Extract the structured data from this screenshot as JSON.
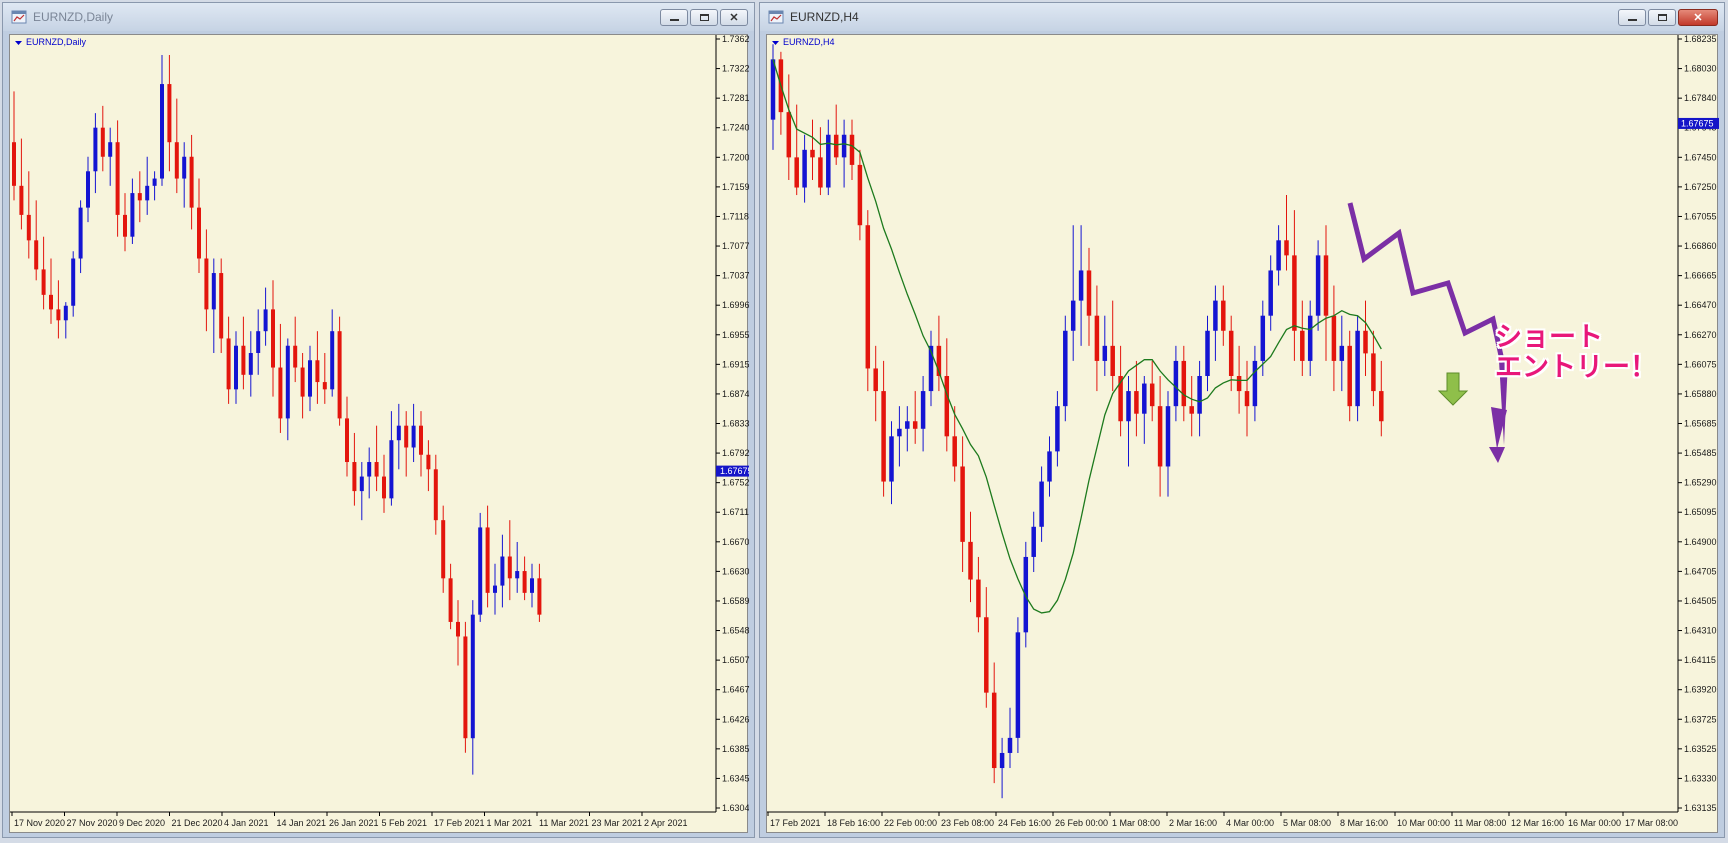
{
  "colors": {
    "chart_bg": "#f7f4dc",
    "bull": "#1414d2",
    "bear": "#e3150d",
    "ma": "#1d7a1d",
    "price_tag_bg": "#1515c8",
    "annotation": "#e8177a",
    "arrow_path": "#7b2fa5",
    "arrow_green": "#8fbf4a"
  },
  "icons": {
    "window_icon": "chart-window-icon",
    "dropdown": "triangle-down-icon"
  },
  "left": {
    "window_title": "EURNZD,Daily",
    "symbol_label": "EURNZD,Daily",
    "price_tag": "1.67675",
    "price_levels": [
      "1.73620",
      "1.73220",
      "1.72810",
      "1.72400",
      "1.72000",
      "1.71590",
      "1.71180",
      "1.70770",
      "1.70370",
      "1.69960",
      "1.69550",
      "1.69150",
      "1.68740",
      "1.68330",
      "1.67920",
      "1.67520",
      "1.67110",
      "1.66700",
      "1.66300",
      "1.65890",
      "1.65480",
      "1.65070",
      "1.64670",
      "1.64260",
      "1.63850",
      "1.63450",
      "1.63040"
    ],
    "time_labels": [
      "17 Nov 2020",
      "27 Nov 2020",
      "9 Dec 2020",
      "21 Dec 2020",
      "4 Jan 2021",
      "14 Jan 2021",
      "26 Jan 2021",
      "5 Feb 2021",
      "17 Feb 2021",
      "1 Mar 2021",
      "11 Mar 2021",
      "23 Mar 2021",
      "2 Apr 2021"
    ]
  },
  "right": {
    "window_title": "EURNZD,H4",
    "symbol_label": "EURNZD,H4",
    "price_tag": "1.67675",
    "price_levels": [
      "1.68235",
      "1.68030",
      "1.67840",
      "1.67645",
      "1.67450",
      "1.67250",
      "1.67055",
      "1.66860",
      "1.66665",
      "1.66470",
      "1.66270",
      "1.66075",
      "1.65880",
      "1.65685",
      "1.65485",
      "1.65290",
      "1.65095",
      "1.64900",
      "1.64705",
      "1.64505",
      "1.64310",
      "1.64115",
      "1.63920",
      "1.63725",
      "1.63525",
      "1.63330",
      "1.63135"
    ],
    "time_labels": [
      "17 Feb 2021",
      "18 Feb 16:00",
      "22 Feb 00:00",
      "23 Feb 08:00",
      "24 Feb 16:00",
      "26 Feb 00:00",
      "1 Mar 08:00",
      "2 Mar 16:00",
      "4 Mar 00:00",
      "5 Mar 08:00",
      "8 Mar 16:00",
      "10 Mar 00:00",
      "11 Mar 08:00",
      "12 Mar 16:00",
      "16 Mar 00:00",
      "17 Mar 08:00"
    ],
    "annotation_line1": "ショート",
    "annotation_line2": "エントリー！"
  },
  "chart_data": [
    {
      "type": "candlestick",
      "title": "EURNZD,Daily",
      "ylim": [
        1.6304,
        1.7362
      ],
      "current_price": 1.67675,
      "candles": [
        [
          1.722,
          1.729,
          1.714,
          1.716
        ],
        [
          1.716,
          1.7225,
          1.71,
          1.712
        ],
        [
          1.712,
          1.718,
          1.706,
          1.7085
        ],
        [
          1.7085,
          1.714,
          1.703,
          1.7045
        ],
        [
          1.7045,
          1.709,
          1.699,
          1.701
        ],
        [
          1.701,
          1.706,
          1.697,
          1.699
        ],
        [
          1.699,
          1.703,
          1.695,
          1.6975
        ],
        [
          1.6975,
          1.7,
          1.695,
          1.6995
        ],
        [
          1.6995,
          1.707,
          1.698,
          1.706
        ],
        [
          1.706,
          1.714,
          1.704,
          1.713
        ],
        [
          1.713,
          1.72,
          1.711,
          1.718
        ],
        [
          1.718,
          1.726,
          1.715,
          1.724
        ],
        [
          1.724,
          1.727,
          1.718,
          1.72
        ],
        [
          1.72,
          1.724,
          1.716,
          1.722
        ],
        [
          1.722,
          1.725,
          1.709,
          1.712
        ],
        [
          1.712,
          1.715,
          1.707,
          1.709
        ],
        [
          1.709,
          1.717,
          1.708,
          1.715
        ],
        [
          1.715,
          1.718,
          1.711,
          1.714
        ],
        [
          1.714,
          1.72,
          1.712,
          1.716
        ],
        [
          1.716,
          1.718,
          1.714,
          1.717
        ],
        [
          1.717,
          1.734,
          1.716,
          1.73
        ],
        [
          1.73,
          1.734,
          1.718,
          1.722
        ],
        [
          1.722,
          1.728,
          1.715,
          1.717
        ],
        [
          1.717,
          1.722,
          1.713,
          1.72
        ],
        [
          1.72,
          1.723,
          1.71,
          1.713
        ],
        [
          1.713,
          1.717,
          1.704,
          1.706
        ],
        [
          1.706,
          1.71,
          1.696,
          1.699
        ],
        [
          1.699,
          1.706,
          1.693,
          1.704
        ],
        [
          1.704,
          1.706,
          1.693,
          1.695
        ],
        [
          1.695,
          1.698,
          1.686,
          1.688
        ],
        [
          1.688,
          1.696,
          1.686,
          1.694
        ],
        [
          1.694,
          1.698,
          1.688,
          1.69
        ],
        [
          1.69,
          1.696,
          1.687,
          1.693
        ],
        [
          1.693,
          1.699,
          1.69,
          1.696
        ],
        [
          1.696,
          1.702,
          1.694,
          1.699
        ],
        [
          1.699,
          1.703,
          1.687,
          1.691
        ],
        [
          1.691,
          1.697,
          1.682,
          1.684
        ],
        [
          1.684,
          1.695,
          1.681,
          1.694
        ],
        [
          1.694,
          1.698,
          1.689,
          1.691
        ],
        [
          1.691,
          1.693,
          1.684,
          1.687
        ],
        [
          1.687,
          1.694,
          1.685,
          1.692
        ],
        [
          1.692,
          1.696,
          1.686,
          1.689
        ],
        [
          1.689,
          1.693,
          1.686,
          1.688
        ],
        [
          1.688,
          1.699,
          1.687,
          1.696
        ],
        [
          1.696,
          1.698,
          1.683,
          1.684
        ],
        [
          1.684,
          1.687,
          1.676,
          1.678
        ],
        [
          1.678,
          1.682,
          1.672,
          1.674
        ],
        [
          1.674,
          1.678,
          1.67,
          1.676
        ],
        [
          1.676,
          1.68,
          1.673,
          1.678
        ],
        [
          1.678,
          1.683,
          1.674,
          1.676
        ],
        [
          1.676,
          1.679,
          1.671,
          1.673
        ],
        [
          1.673,
          1.685,
          1.672,
          1.681
        ],
        [
          1.681,
          1.686,
          1.677,
          1.683
        ],
        [
          1.683,
          1.685,
          1.676,
          1.68
        ],
        [
          1.68,
          1.686,
          1.678,
          1.683
        ],
        [
          1.683,
          1.685,
          1.676,
          1.679
        ],
        [
          1.679,
          1.681,
          1.674,
          1.677
        ],
        [
          1.677,
          1.679,
          1.668,
          1.67
        ],
        [
          1.67,
          1.672,
          1.66,
          1.662
        ],
        [
          1.662,
          1.664,
          1.655,
          1.656
        ],
        [
          1.656,
          1.659,
          1.65,
          1.654
        ],
        [
          1.654,
          1.656,
          1.638,
          1.64
        ],
        [
          1.64,
          1.659,
          1.635,
          1.657
        ],
        [
          1.657,
          1.671,
          1.656,
          1.669
        ],
        [
          1.669,
          1.672,
          1.658,
          1.66
        ],
        [
          1.66,
          1.664,
          1.657,
          1.661
        ],
        [
          1.661,
          1.668,
          1.658,
          1.665
        ],
        [
          1.665,
          1.67,
          1.659,
          1.662
        ],
        [
          1.662,
          1.667,
          1.66,
          1.663
        ],
        [
          1.663,
          1.665,
          1.659,
          1.66
        ],
        [
          1.66,
          1.664,
          1.658,
          1.662
        ],
        [
          1.662,
          1.664,
          1.656,
          1.657
        ]
      ]
    },
    {
      "type": "candlestick",
      "title": "EURNZD,H4",
      "ylim": [
        1.63135,
        1.68235
      ],
      "current_price": 1.67675,
      "moving_average": true,
      "candles": [
        [
          1.677,
          1.682,
          1.675,
          1.681
        ],
        [
          1.681,
          1.6815,
          1.676,
          1.6775
        ],
        [
          1.6775,
          1.68,
          1.673,
          1.6745
        ],
        [
          1.6745,
          1.678,
          1.672,
          1.6725
        ],
        [
          1.6725,
          1.676,
          1.6715,
          1.675
        ],
        [
          1.675,
          1.677,
          1.673,
          1.6745
        ],
        [
          1.6745,
          1.6765,
          1.672,
          1.6725
        ],
        [
          1.6725,
          1.677,
          1.672,
          1.676
        ],
        [
          1.676,
          1.678,
          1.674,
          1.6745
        ],
        [
          1.6745,
          1.677,
          1.6725,
          1.676
        ],
        [
          1.676,
          1.677,
          1.673,
          1.674
        ],
        [
          1.674,
          1.675,
          1.669,
          1.67
        ],
        [
          1.67,
          1.671,
          1.659,
          1.6605
        ],
        [
          1.6605,
          1.662,
          1.657,
          1.659
        ],
        [
          1.659,
          1.661,
          1.652,
          1.653
        ],
        [
          1.653,
          1.657,
          1.6515,
          1.656
        ],
        [
          1.656,
          1.658,
          1.654,
          1.6565
        ],
        [
          1.6565,
          1.658,
          1.655,
          1.657
        ],
        [
          1.657,
          1.659,
          1.6555,
          1.6565
        ],
        [
          1.6565,
          1.66,
          1.655,
          1.659
        ],
        [
          1.659,
          1.663,
          1.658,
          1.662
        ],
        [
          1.662,
          1.664,
          1.659,
          1.66
        ],
        [
          1.66,
          1.6625,
          1.655,
          1.656
        ],
        [
          1.656,
          1.658,
          1.653,
          1.654
        ],
        [
          1.654,
          1.656,
          1.647,
          1.649
        ],
        [
          1.649,
          1.651,
          1.645,
          1.6465
        ],
        [
          1.6465,
          1.648,
          1.643,
          1.644
        ],
        [
          1.644,
          1.646,
          1.638,
          1.639
        ],
        [
          1.639,
          1.641,
          1.633,
          1.634
        ],
        [
          1.634,
          1.636,
          1.632,
          1.635
        ],
        [
          1.635,
          1.638,
          1.634,
          1.636
        ],
        [
          1.636,
          1.644,
          1.635,
          1.643
        ],
        [
          1.643,
          1.649,
          1.642,
          1.648
        ],
        [
          1.648,
          1.651,
          1.647,
          1.65
        ],
        [
          1.65,
          1.654,
          1.649,
          1.653
        ],
        [
          1.653,
          1.656,
          1.652,
          1.655
        ],
        [
          1.655,
          1.659,
          1.654,
          1.658
        ],
        [
          1.658,
          1.664,
          1.657,
          1.663
        ],
        [
          1.663,
          1.67,
          1.661,
          1.665
        ],
        [
          1.665,
          1.67,
          1.662,
          1.667
        ],
        [
          1.667,
          1.6685,
          1.662,
          1.664
        ],
        [
          1.664,
          1.666,
          1.659,
          1.661
        ],
        [
          1.661,
          1.664,
          1.66,
          1.662
        ],
        [
          1.662,
          1.665,
          1.659,
          1.66
        ],
        [
          1.66,
          1.662,
          1.656,
          1.657
        ],
        [
          1.657,
          1.66,
          1.654,
          1.659
        ],
        [
          1.659,
          1.661,
          1.656,
          1.6575
        ],
        [
          1.6575,
          1.66,
          1.6555,
          1.6595
        ],
        [
          1.6595,
          1.661,
          1.657,
          1.658
        ],
        [
          1.658,
          1.66,
          1.652,
          1.654
        ],
        [
          1.654,
          1.659,
          1.652,
          1.658
        ],
        [
          1.658,
          1.662,
          1.657,
          1.661
        ],
        [
          1.661,
          1.662,
          1.657,
          1.658
        ],
        [
          1.658,
          1.66,
          1.656,
          1.6575
        ],
        [
          1.6575,
          1.661,
          1.656,
          1.66
        ],
        [
          1.66,
          1.664,
          1.659,
          1.663
        ],
        [
          1.663,
          1.666,
          1.661,
          1.665
        ],
        [
          1.665,
          1.666,
          1.662,
          1.663
        ],
        [
          1.663,
          1.664,
          1.659,
          1.66
        ],
        [
          1.66,
          1.662,
          1.6575,
          1.659
        ],
        [
          1.659,
          1.661,
          1.656,
          1.658
        ],
        [
          1.658,
          1.662,
          1.657,
          1.661
        ],
        [
          1.661,
          1.665,
          1.66,
          1.664
        ],
        [
          1.664,
          1.668,
          1.663,
          1.667
        ],
        [
          1.667,
          1.67,
          1.666,
          1.669
        ],
        [
          1.669,
          1.672,
          1.667,
          1.668
        ],
        [
          1.668,
          1.671,
          1.661,
          1.663
        ],
        [
          1.663,
          1.665,
          1.66,
          1.661
        ],
        [
          1.661,
          1.665,
          1.66,
          1.664
        ],
        [
          1.664,
          1.669,
          1.663,
          1.668
        ],
        [
          1.668,
          1.67,
          1.661,
          1.664
        ],
        [
          1.664,
          1.666,
          1.659,
          1.661
        ],
        [
          1.661,
          1.664,
          1.659,
          1.662
        ],
        [
          1.662,
          1.663,
          1.657,
          1.658
        ],
        [
          1.658,
          1.664,
          1.657,
          1.663
        ],
        [
          1.663,
          1.665,
          1.66,
          1.6615
        ],
        [
          1.6615,
          1.663,
          1.658,
          1.659
        ],
        [
          1.659,
          1.661,
          1.656,
          1.657
        ]
      ]
    }
  ]
}
